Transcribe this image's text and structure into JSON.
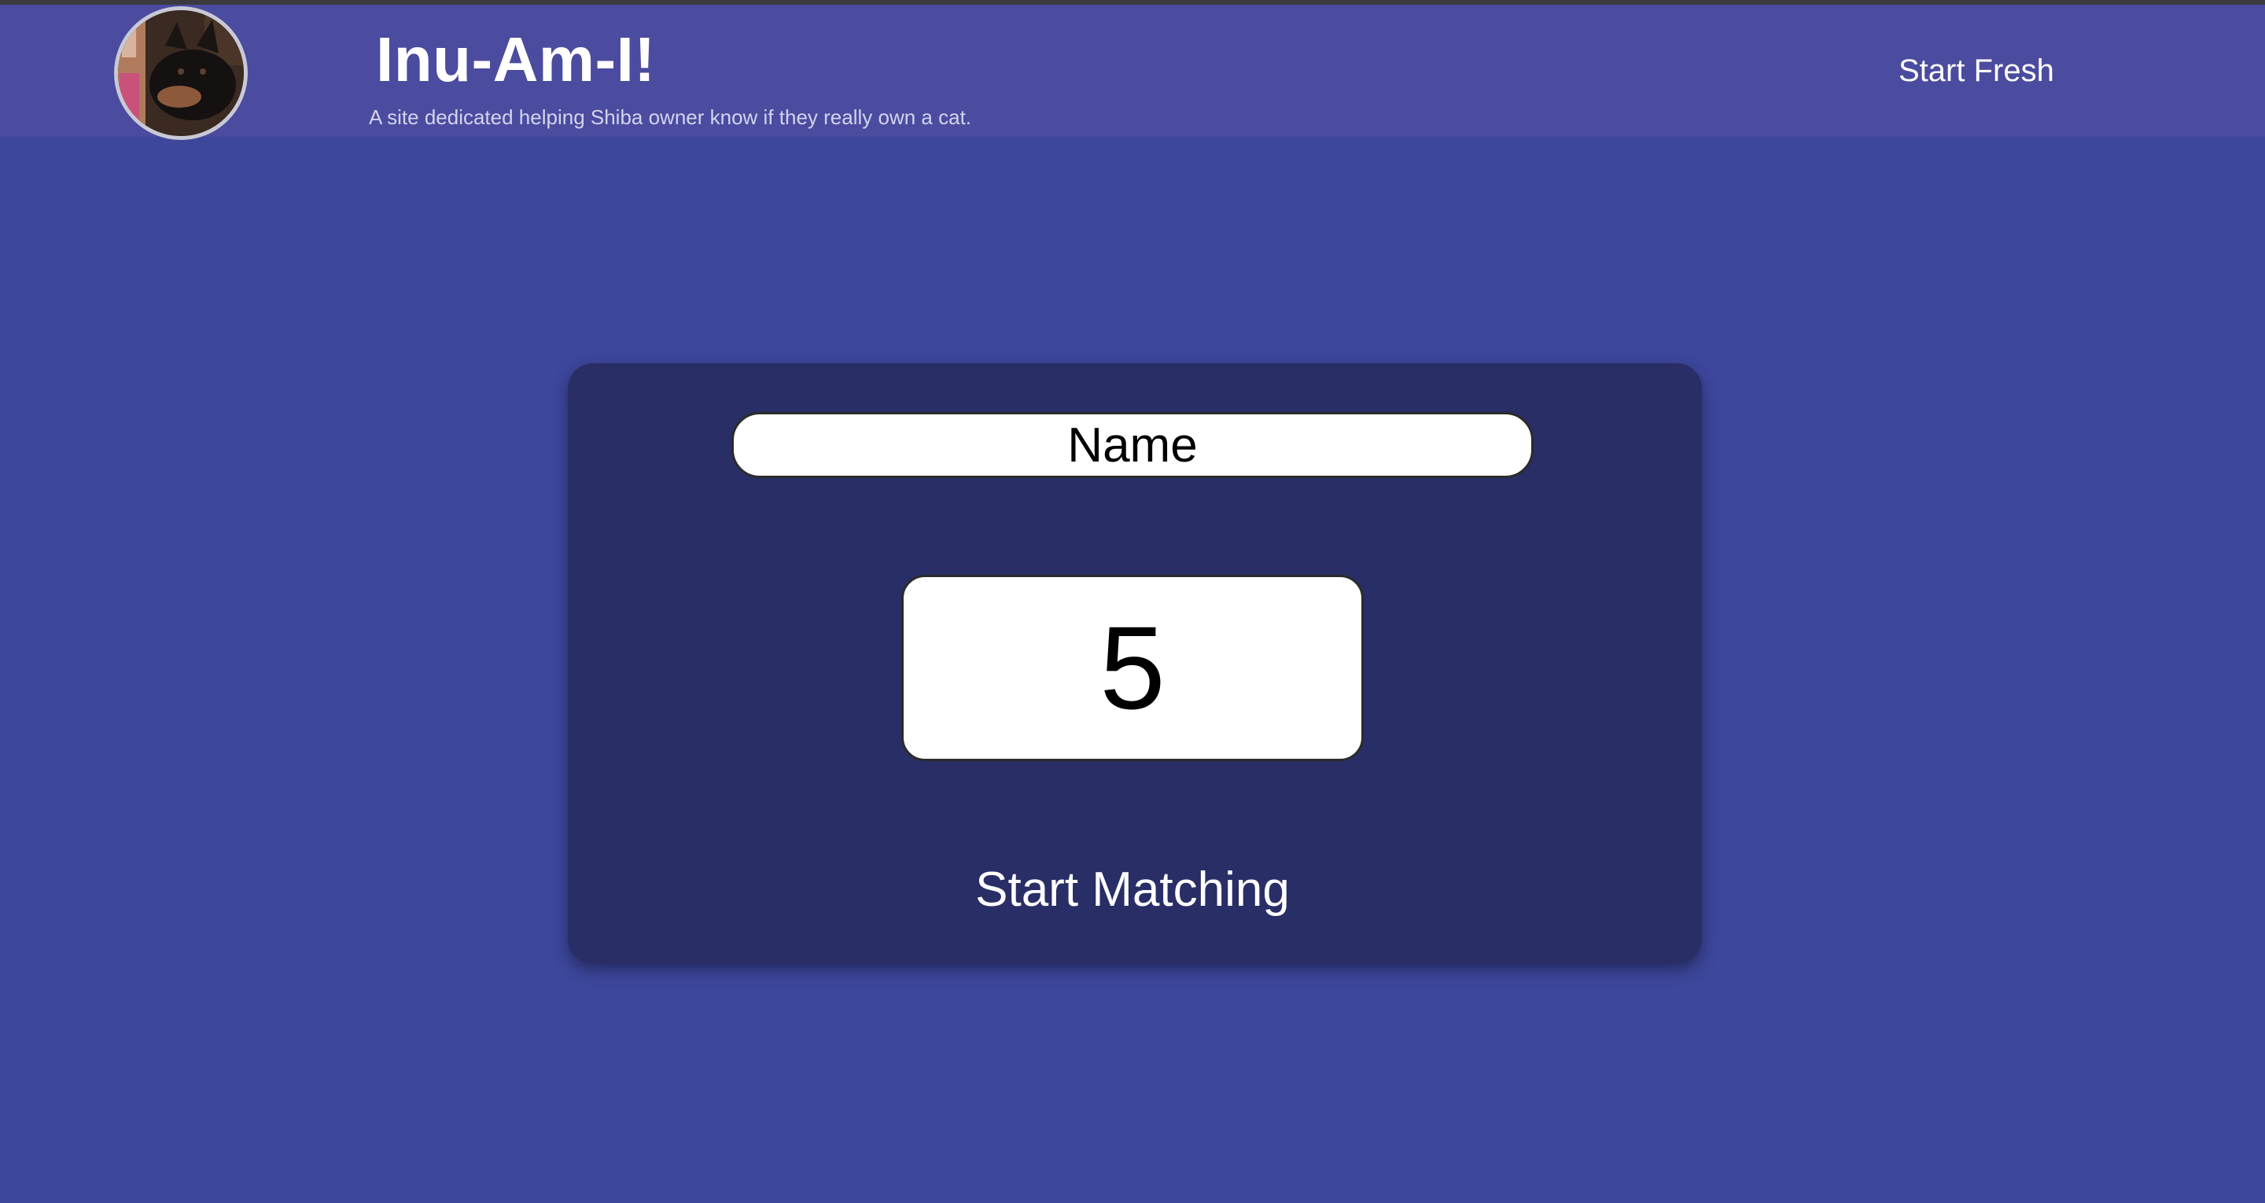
{
  "header": {
    "title": "Inu-Am-I!",
    "subtitle": "A site dedicated helping Shiba owner know if they really own a cat.",
    "avatar_icon": "dog-photo-avatar",
    "nav_link": "Start Fresh"
  },
  "form": {
    "name_placeholder": "Name",
    "number_value": "5",
    "submit_label": "Start Matching"
  },
  "colors": {
    "page_background": "#3d479b",
    "header_background": "#4b4b9f",
    "card_background": "#292e66",
    "input_background": "#ffffff",
    "text_light": "#ffffff"
  }
}
